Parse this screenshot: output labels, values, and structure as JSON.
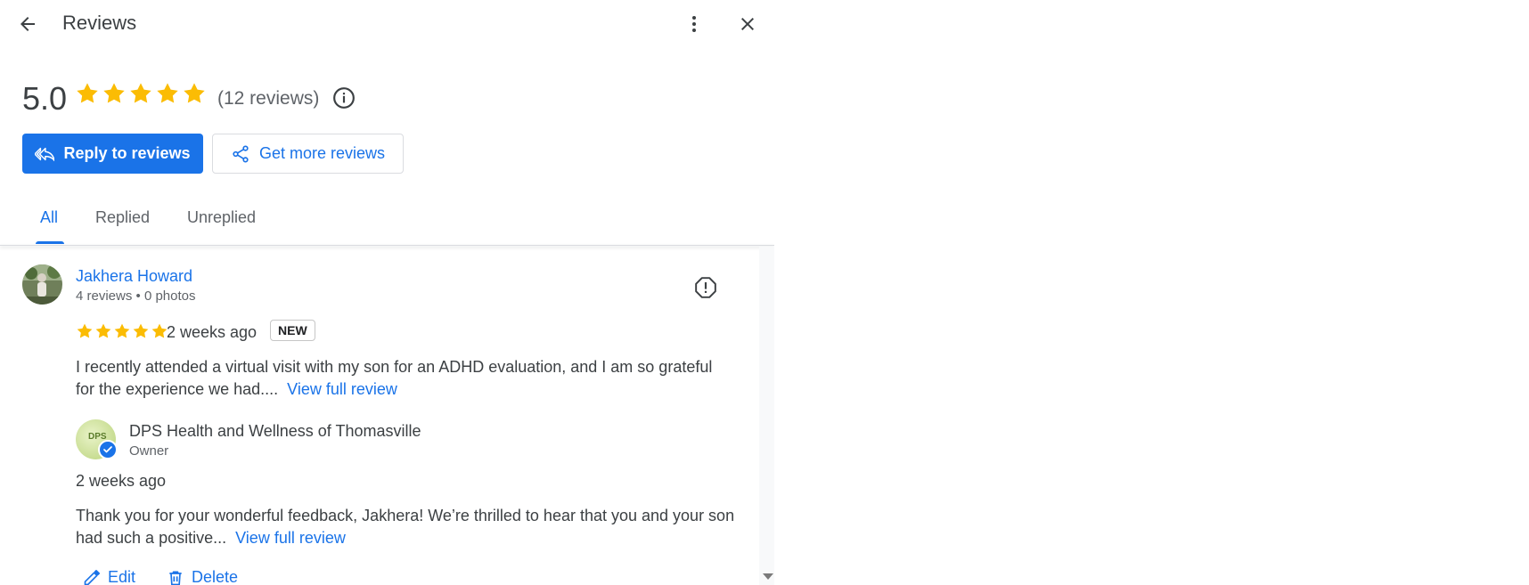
{
  "header": {
    "title": "Reviews",
    "back_icon": "arrow-back-icon",
    "more_icon": "more-vert-icon",
    "close_icon": "close-icon"
  },
  "summary": {
    "rating": "5.0",
    "stars": 5,
    "review_count": "(12 reviews)",
    "info_icon": "info-icon"
  },
  "actions": {
    "reply_label": "Reply to reviews",
    "get_more_label": "Get more reviews"
  },
  "tabs": [
    {
      "label": "All",
      "active": true
    },
    {
      "label": "Replied",
      "active": false
    },
    {
      "label": "Unreplied",
      "active": false
    }
  ],
  "review": {
    "reviewer_name": "Jakhera Howard",
    "reviewer_meta": "4 reviews • 0 photos",
    "stars": 5,
    "time": "2 weeks ago",
    "badge": "NEW",
    "text": "I recently attended a virtual visit with my son for an ADHD evaluation, and I am so grateful for the experience we had....",
    "view_full": "View full review",
    "flag_icon": "report-icon"
  },
  "reply": {
    "owner_name": "DPS Health and Wellness of Thomasville",
    "owner_role": "Owner",
    "avatar_text": "DPS",
    "time": "2 weeks ago",
    "text": "Thank you for your wonderful feedback, Jakhera! We’re thrilled to hear that you and your son had such a positive...",
    "view_full": "View full review",
    "edit_label": "Edit",
    "delete_label": "Delete"
  },
  "colors": {
    "accent": "#1a73e8",
    "star": "#fbbc04",
    "text": "#3c4043",
    "muted": "#5f6368"
  }
}
